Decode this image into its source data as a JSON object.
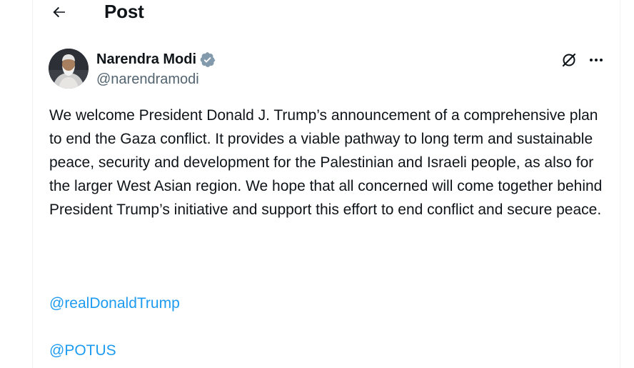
{
  "header": {
    "title": "Post",
    "back_icon": "arrow-left-icon"
  },
  "author": {
    "display_name": "Narendra Modi",
    "handle": "@narendramodi",
    "verified": true,
    "verified_color": "#829aab"
  },
  "actions": {
    "grok_icon": "grok-icon",
    "more_icon": "more-horizontal-icon"
  },
  "tweet": {
    "text": "We welcome President Donald J. Trump’s announcement of  a comprehensive plan to end the Gaza conflict. It provides a viable pathway to long term and sustainable peace, security and development for the Palestinian and Israeli people, as also for the larger West Asian region. We hope that all concerned will come together behind President Trump’s initiative and support this effort to end conflict and secure peace.",
    "mentions": [
      "@realDonaldTrump",
      "@POTUS"
    ]
  },
  "colors": {
    "text": "#0f1419",
    "secondary": "#536471",
    "link": "#1d9bf0",
    "border": "#eff3f4"
  }
}
